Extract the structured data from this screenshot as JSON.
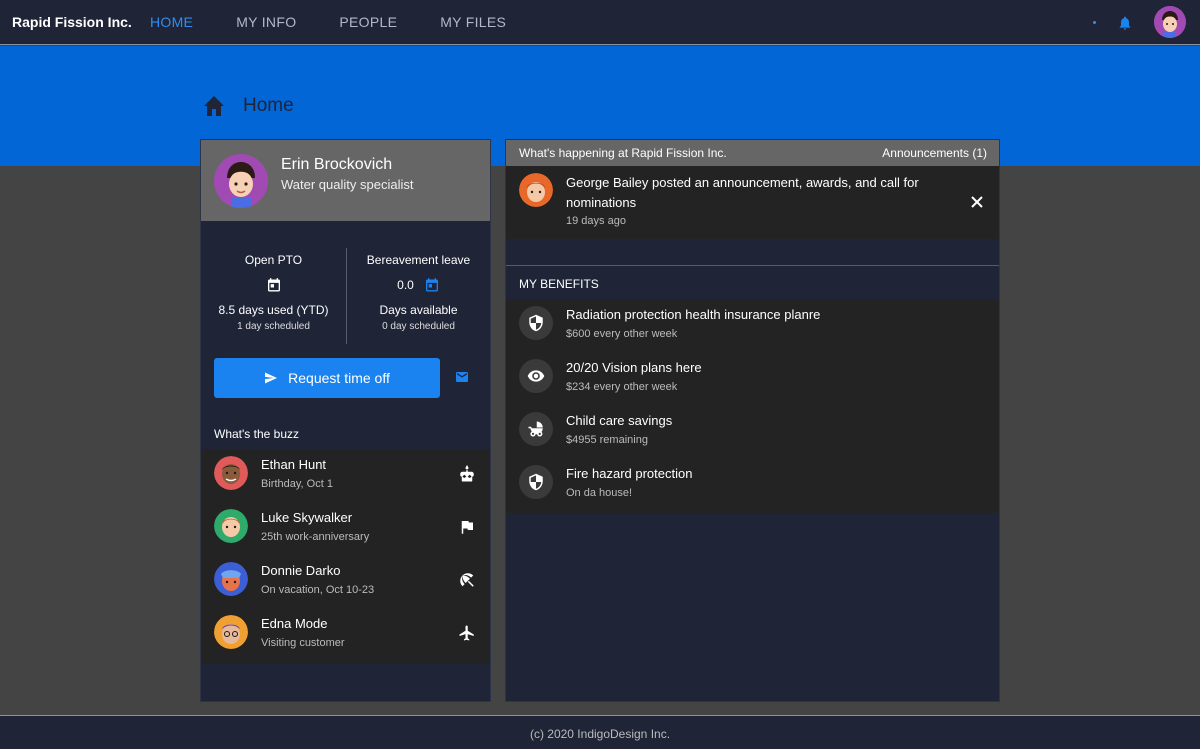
{
  "header": {
    "brand": "Rapid Fission Inc.",
    "nav": [
      "HOME",
      "MY INFO",
      "PEOPLE",
      "MY FILES"
    ],
    "active_nav": "HOME"
  },
  "page": {
    "title": "Home"
  },
  "profile": {
    "name": "Erin Brockovich",
    "role": "Water quality specialist"
  },
  "pto": {
    "open": {
      "title": "Open PTO",
      "used": "8.5 days used (YTD)",
      "scheduled": "1 day scheduled"
    },
    "bereavement": {
      "title": "Bereavement leave",
      "value": "0.0",
      "available": "Days available",
      "scheduled": "0 day scheduled"
    }
  },
  "request_button": "Request time off",
  "buzz": {
    "label": "What's the buzz",
    "items": [
      {
        "name": "Ethan Hunt",
        "detail": "Birthday, Oct 1",
        "icon": "cake-icon"
      },
      {
        "name": "Luke Skywalker",
        "detail": "25th work-anniversary",
        "icon": "flag-icon"
      },
      {
        "name": "Donnie Darko",
        "detail": "On vacation, Oct 10-23",
        "icon": "beach-umbrella-icon"
      },
      {
        "name": "Edna Mode",
        "detail": "Visiting customer",
        "icon": "airplane-icon"
      }
    ]
  },
  "happening": {
    "title": "What's happening at Rapid Fission Inc.",
    "announcements_label": "Announcements (1)",
    "announcement": {
      "text": "George Bailey posted an announcement, awards, and call for nominations",
      "time": "19 days ago"
    }
  },
  "benefits": {
    "label": "MY BENEFITS",
    "items": [
      {
        "name": "Radiation protection health insurance planre",
        "detail": "$600 every other week",
        "icon": "shield-icon"
      },
      {
        "name": "20/20 Vision plans here",
        "detail": "$234 every other week",
        "icon": "eye-icon"
      },
      {
        "name": "Child care savings",
        "detail": "$4955 remaining",
        "icon": "stroller-icon"
      },
      {
        "name": "Fire hazard protection",
        "detail": "On da house!",
        "icon": "shield-icon"
      }
    ]
  },
  "footer": {
    "text": "(c) 2020 IndigoDesign Inc."
  },
  "colors": {
    "accent": "#1a83f0",
    "hero": "#0366d6",
    "nav_active": "#2f8ef3",
    "topbar": "#1f2437"
  }
}
